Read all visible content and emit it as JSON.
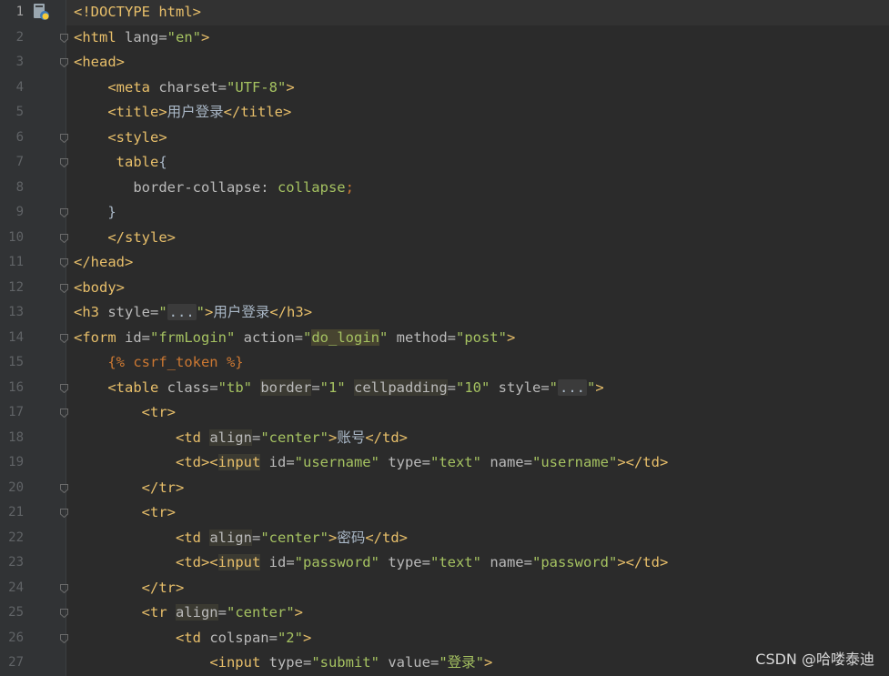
{
  "editor": {
    "file_icon": "python-file-icon",
    "watermark": "CSDN @哈喽泰迪",
    "lines": [
      {
        "n": "1",
        "tokens": [
          [
            "tag",
            "<!DOCTYPE html>"
          ]
        ]
      },
      {
        "n": "2",
        "tokens": [
          [
            "tag",
            "<html "
          ],
          [
            "attr",
            "lang="
          ],
          [
            "val",
            "\"en\""
          ],
          [
            "tag",
            ">"
          ]
        ]
      },
      {
        "n": "3",
        "tokens": [
          [
            "tag",
            "<head>"
          ]
        ]
      },
      {
        "n": "4",
        "tokens": [
          [
            "txt",
            "    "
          ],
          [
            "tag",
            "<meta "
          ],
          [
            "attr",
            "charset="
          ],
          [
            "val",
            "\"UTF-8\""
          ],
          [
            "tag",
            ">"
          ]
        ]
      },
      {
        "n": "5",
        "tokens": [
          [
            "txt",
            "    "
          ],
          [
            "tag",
            "<title>"
          ],
          [
            "txt",
            "用户登录"
          ],
          [
            "tag",
            "</title>"
          ]
        ]
      },
      {
        "n": "6",
        "tokens": [
          [
            "txt",
            "    "
          ],
          [
            "tag",
            "<style>"
          ]
        ]
      },
      {
        "n": "7",
        "tokens": [
          [
            "txt",
            "     "
          ],
          [
            "tag",
            "table"
          ],
          [
            "txt",
            "{"
          ]
        ]
      },
      {
        "n": "8",
        "tokens": [
          [
            "txt",
            "       "
          ],
          [
            "attr",
            "border-collapse: "
          ],
          [
            "val",
            "collapse"
          ],
          [
            "tpl",
            ";"
          ]
        ]
      },
      {
        "n": "9",
        "tokens": [
          [
            "txt",
            "    }"
          ]
        ]
      },
      {
        "n": "10",
        "tokens": [
          [
            "txt",
            "    "
          ],
          [
            "tag",
            "</style>"
          ]
        ]
      },
      {
        "n": "11",
        "tokens": [
          [
            "tag",
            "</head>"
          ]
        ]
      },
      {
        "n": "12",
        "tokens": [
          [
            "tag",
            "<body>"
          ]
        ]
      },
      {
        "n": "13",
        "tokens": [
          [
            "tag",
            "<h3 "
          ],
          [
            "attr",
            "style="
          ],
          [
            "val",
            "\""
          ],
          [
            "dots",
            "..."
          ],
          [
            "val",
            "\""
          ],
          [
            "tag",
            ">"
          ],
          [
            "txt",
            "用户登录"
          ],
          [
            "tag",
            "</h3>"
          ]
        ]
      },
      {
        "n": "14",
        "tokens": [
          [
            "tag",
            "<form "
          ],
          [
            "attr",
            "id="
          ],
          [
            "val",
            "\"frmLogin\" "
          ],
          [
            "attr",
            "action="
          ],
          [
            "val",
            "\""
          ],
          [
            "hlval",
            "do_login"
          ],
          [
            "val",
            "\" "
          ],
          [
            "attr",
            "method="
          ],
          [
            "val",
            "\"post\""
          ],
          [
            "tag",
            ">"
          ]
        ]
      },
      {
        "n": "15",
        "tokens": [
          [
            "txt",
            "    "
          ],
          [
            "tpl",
            "{% csrf_token %}"
          ]
        ]
      },
      {
        "n": "16",
        "tokens": [
          [
            "txt",
            "    "
          ],
          [
            "tag",
            "<table "
          ],
          [
            "attr",
            "class="
          ],
          [
            "val",
            "\"tb\" "
          ],
          [
            "hlattr",
            "border"
          ],
          [
            "attr",
            "="
          ],
          [
            "val",
            "\"1\" "
          ],
          [
            "hlattr",
            "cellpadding"
          ],
          [
            "attr",
            "="
          ],
          [
            "val",
            "\"10\" "
          ],
          [
            "attr",
            "style="
          ],
          [
            "val",
            "\""
          ],
          [
            "dots",
            "..."
          ],
          [
            "val",
            "\""
          ],
          [
            "tag",
            ">"
          ]
        ]
      },
      {
        "n": "17",
        "tokens": [
          [
            "txt",
            "        "
          ],
          [
            "tag",
            "<tr>"
          ]
        ]
      },
      {
        "n": "18",
        "tokens": [
          [
            "txt",
            "            "
          ],
          [
            "tag",
            "<td "
          ],
          [
            "hlattr",
            "align"
          ],
          [
            "attr",
            "="
          ],
          [
            "val",
            "\"center\""
          ],
          [
            "tag",
            ">"
          ],
          [
            "txt",
            "账号"
          ],
          [
            "tag",
            "</td>"
          ]
        ]
      },
      {
        "n": "19",
        "tokens": [
          [
            "txt",
            "            "
          ],
          [
            "tag",
            "<td><"
          ],
          [
            "hltag",
            "input"
          ],
          [
            "attr",
            " id="
          ],
          [
            "val",
            "\"username\" "
          ],
          [
            "attr",
            "type="
          ],
          [
            "val",
            "\"text\" "
          ],
          [
            "attr",
            "name="
          ],
          [
            "val",
            "\"username\""
          ],
          [
            "tag",
            "></td>"
          ]
        ]
      },
      {
        "n": "20",
        "tokens": [
          [
            "txt",
            "        "
          ],
          [
            "tag",
            "</tr>"
          ]
        ]
      },
      {
        "n": "21",
        "tokens": [
          [
            "txt",
            "        "
          ],
          [
            "tag",
            "<tr>"
          ]
        ]
      },
      {
        "n": "22",
        "tokens": [
          [
            "txt",
            "            "
          ],
          [
            "tag",
            "<td "
          ],
          [
            "hlattr",
            "align"
          ],
          [
            "attr",
            "="
          ],
          [
            "val",
            "\"center\""
          ],
          [
            "tag",
            ">"
          ],
          [
            "txt",
            "密码"
          ],
          [
            "tag",
            "</td>"
          ]
        ]
      },
      {
        "n": "23",
        "tokens": [
          [
            "txt",
            "            "
          ],
          [
            "tag",
            "<td><"
          ],
          [
            "hltag",
            "input"
          ],
          [
            "attr",
            " id="
          ],
          [
            "val",
            "\"password\" "
          ],
          [
            "attr",
            "type="
          ],
          [
            "val",
            "\"text\" "
          ],
          [
            "attr",
            "name="
          ],
          [
            "val",
            "\"password\""
          ],
          [
            "tag",
            "></td>"
          ]
        ]
      },
      {
        "n": "24",
        "tokens": [
          [
            "txt",
            "        "
          ],
          [
            "tag",
            "</tr>"
          ]
        ]
      },
      {
        "n": "25",
        "tokens": [
          [
            "txt",
            "        "
          ],
          [
            "tag",
            "<tr "
          ],
          [
            "hlattr",
            "align"
          ],
          [
            "attr",
            "="
          ],
          [
            "val",
            "\"center\""
          ],
          [
            "tag",
            ">"
          ]
        ]
      },
      {
        "n": "26",
        "tokens": [
          [
            "txt",
            "            "
          ],
          [
            "tag",
            "<td "
          ],
          [
            "attr",
            "colspan="
          ],
          [
            "val",
            "\"2\""
          ],
          [
            "tag",
            ">"
          ]
        ]
      },
      {
        "n": "27",
        "tokens": [
          [
            "txt",
            "                "
          ],
          [
            "tag",
            "<input "
          ],
          [
            "attr",
            "type="
          ],
          [
            "val",
            "\"submit\" "
          ],
          [
            "attr",
            "value="
          ],
          [
            "val",
            "\"登录\""
          ],
          [
            "tag",
            ">"
          ]
        ]
      }
    ],
    "fold_lines": [
      "2",
      "3",
      "6",
      "7",
      "9",
      "10",
      "11",
      "12",
      "14",
      "16",
      "17",
      "20",
      "21",
      "24",
      "25",
      "26"
    ]
  }
}
